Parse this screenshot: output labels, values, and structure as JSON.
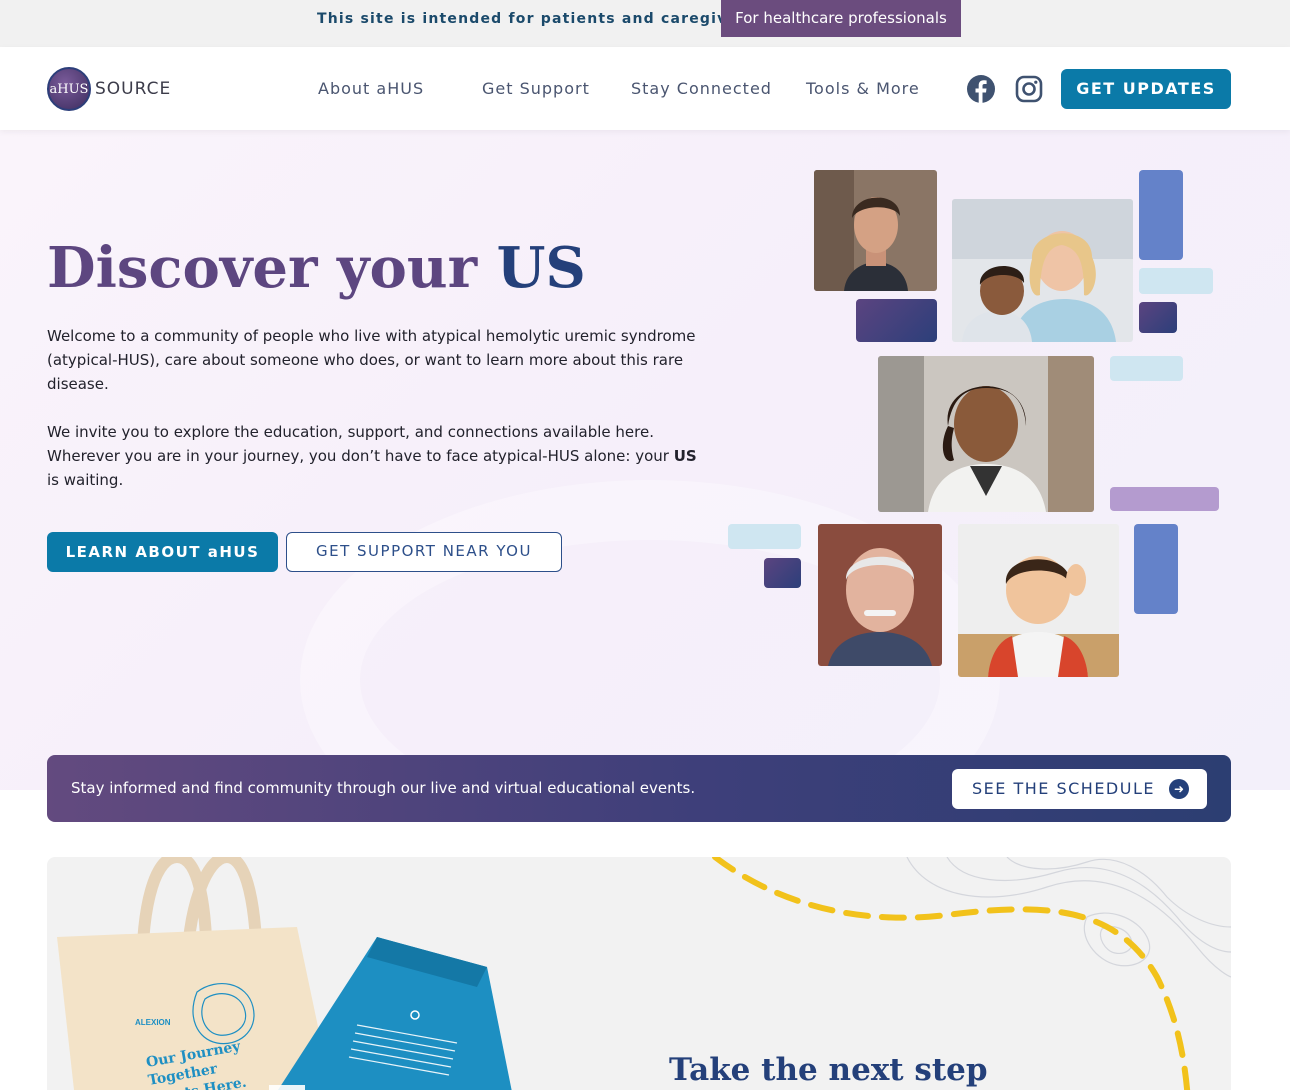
{
  "topbar": {
    "notice": "This site is intended for patients and caregivers.",
    "hcp_link": "For healthcare professionals"
  },
  "header": {
    "logo_mark": "aHUS",
    "logo_text": "SOURCE",
    "nav": [
      "About aHUS",
      "Get Support",
      "Stay Connected",
      "Tools & More"
    ],
    "social_icons": [
      "facebook-icon",
      "instagram-icon"
    ],
    "cta": "GET UPDATES"
  },
  "hero": {
    "title_part1": "Discover your",
    "title_part2": "US",
    "para1": "Welcome to a community of people who live with atypical hemolytic uremic syndrome (atypical-HUS), care about someone who does, or want to learn more about this rare disease.",
    "para2_start": "We invite you to explore the education, support, and connections available here. Wherever you are in your journey, you don’t have to face atypical-HUS alone: your ",
    "para2_bold": "US",
    "para2_end": " is waiting.",
    "primary_button": "LEARN ABOUT aHUS",
    "secondary_button": "GET SUPPORT NEAR YOU"
  },
  "banner": {
    "text": "Stay informed and find community through our live and virtual educational events.",
    "button": "SEE THE SCHEDULE",
    "arrow_icon": "arrow-right-icon"
  },
  "next_step": {
    "title": "Take the next step",
    "tote_brand": "ALEXION",
    "tote_text": "Our Journey Together Starts Here."
  },
  "colors": {
    "primary_blue": "#0b7aa8",
    "navy": "#24407a",
    "purple": "#5d4680",
    "hcp_purple": "#6b4c7e"
  }
}
